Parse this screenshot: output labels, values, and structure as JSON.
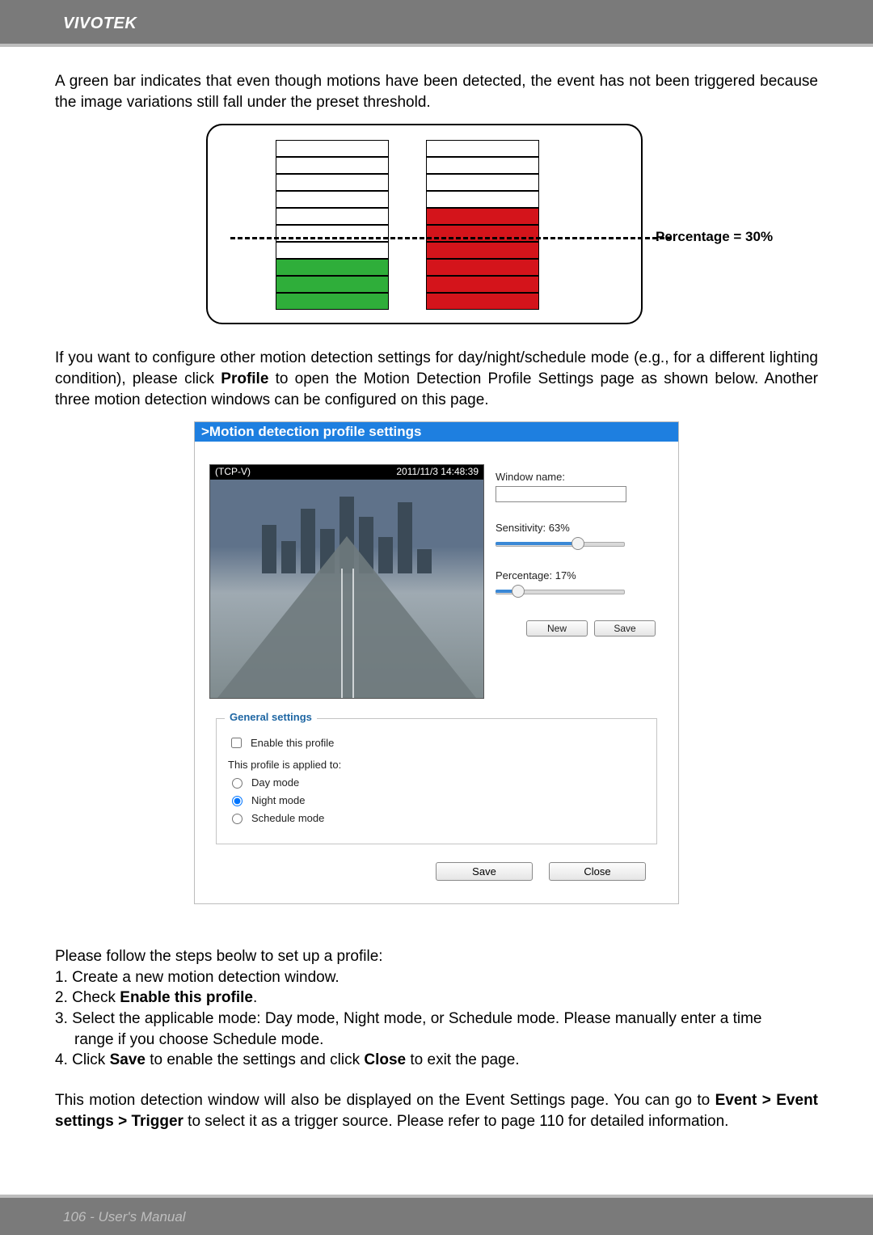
{
  "brand": "VIVOTEK",
  "para1": "A green bar indicates that even though motions have been detected, the event has not been triggered because the image variations still fall under the preset threshold.",
  "diagram1": {
    "label": "Percentage = 30%"
  },
  "para2_pre": "If you want to configure other motion detection settings for day/night/schedule mode (e.g., for a different lighting condition), please click ",
  "para2_bold": "Profile",
  "para2_post": " to open the Motion Detection Profile Settings page as shown below. Another three motion detection windows can be configured on this page.",
  "panel": {
    "title": ">Motion detection profile settings",
    "preview": {
      "left_text": "(TCP-V)",
      "timestamp": "2011/11/3 14:48:39"
    },
    "controls": {
      "window_name_label": "Window name:",
      "window_name_value": "",
      "sensitivity_label": "Sensitivity: 63%",
      "sensitivity_pct": 63,
      "percentage_label": "Percentage: 17%",
      "percentage_pct": 17,
      "new_btn": "New",
      "save_btn": "Save"
    },
    "general": {
      "legend": "General settings",
      "enable_label": "Enable this profile",
      "enable_checked": false,
      "applied_label": "This profile is applied to:",
      "modes": {
        "day": "Day mode",
        "night": "Night mode",
        "schedule": "Schedule mode",
        "selected": "night"
      }
    },
    "bottom": {
      "save": "Save",
      "close": "Close"
    }
  },
  "steps": {
    "intro": "Please follow the steps beolw to set up a profile:",
    "s1": "1. Create a new motion detection window.",
    "s2_pre": "2. Check ",
    "s2_bold": "Enable this profile",
    "s2_post": ".",
    "s3": "3. Select the applicable mode: Day mode, Night mode, or Schedule mode. Please manually enter a time range if you choose Schedule mode.",
    "s3_line1": "3. Select the applicable mode: Day mode, Night mode, or Schedule mode. Please manually enter a time",
    "s3_line2": "range if you choose Schedule mode.",
    "s4_pre": "4. Click ",
    "s4_b1": "Save",
    "s4_mid": " to enable the settings and click ",
    "s4_b2": "Close",
    "s4_post": " to exit the page."
  },
  "para3_pre": "This motion detection window will also be displayed on the Event Settings page. You can go to ",
  "para3_b1": "Event > Event settings > Trigger",
  "para3_post": " to select it as a trigger source. Please refer to page 110 for detailed information.",
  "footer": "106 - User's Manual"
}
